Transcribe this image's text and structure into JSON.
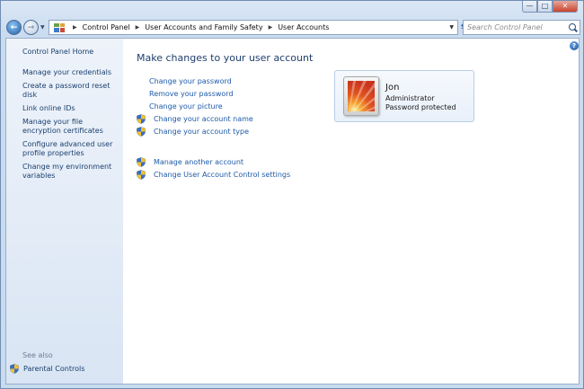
{
  "window": {
    "caption_buttons": {
      "minimize": "—",
      "maximize": "□",
      "close": "✕"
    }
  },
  "navbar": {
    "back": "←",
    "forward": "→",
    "breadcrumbs": [
      "Control Panel",
      "User Accounts and Family Safety",
      "User Accounts"
    ],
    "search_placeholder": "Search Control Panel"
  },
  "sidebar": {
    "home": "Control Panel Home",
    "items": [
      "Manage your credentials",
      "Create a password reset disk",
      "Link online IDs",
      "Manage your file encryption certificates",
      "Configure advanced user profile properties",
      "Change my environment variables"
    ],
    "see_also": "See also",
    "parental_controls": "Parental Controls"
  },
  "main": {
    "help": "?",
    "heading": "Make changes to your user account",
    "tasks": [
      {
        "label": "Change your password",
        "shield": false
      },
      {
        "label": "Remove your password",
        "shield": false
      },
      {
        "label": "Change your picture",
        "shield": false
      },
      {
        "label": "Change your account name",
        "shield": true
      },
      {
        "label": "Change your account type",
        "shield": true
      }
    ],
    "other_tasks": [
      {
        "label": "Manage another account",
        "shield": true
      },
      {
        "label": "Change User Account Control settings",
        "shield": true
      }
    ]
  },
  "account": {
    "name": "Jon",
    "type": "Administrator",
    "status": "Password protected"
  }
}
